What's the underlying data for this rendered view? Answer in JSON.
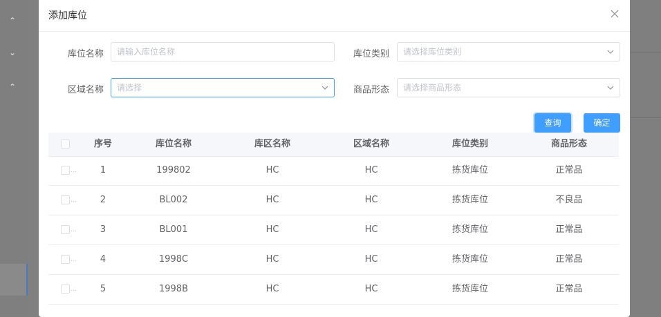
{
  "dialog": {
    "title": "添加库位"
  },
  "form": {
    "location_name_label": "库位名称",
    "location_name_placeholder": "请输入库位名称",
    "location_type_label": "库位类别",
    "location_type_placeholder": "请选择库位类别",
    "area_name_label": "区域名称",
    "area_name_placeholder": "请选择",
    "goods_form_label": "商品形态",
    "goods_form_placeholder": "请选择商品形态"
  },
  "buttons": {
    "query": "查询",
    "confirm": "确定"
  },
  "table": {
    "headers": [
      "序号",
      "库位名称",
      "库区名称",
      "区域名称",
      "库位类别",
      "商品形态"
    ],
    "rows": [
      [
        "1",
        "199802",
        "HC",
        "HC",
        "拣货库位",
        "正常品"
      ],
      [
        "2",
        "BL002",
        "HC",
        "HC",
        "拣货库位",
        "不良品"
      ],
      [
        "3",
        "BL001",
        "HC",
        "HC",
        "拣货库位",
        "正常品"
      ],
      [
        "4",
        "1998C",
        "HC",
        "HC",
        "拣货库位",
        "正常品"
      ],
      [
        "5",
        "1998B",
        "HC",
        "HC",
        "拣货库位",
        "正常品"
      ]
    ],
    "checkbox_overflow": "..."
  },
  "icons": {
    "close": "close-icon",
    "dropdown": "chevron-down-icon",
    "sidebar_up": "chevron-up-icon",
    "sidebar_down": "chevron-down-icon"
  },
  "colors": {
    "primary": "#409eff",
    "overlay": "#808080"
  }
}
